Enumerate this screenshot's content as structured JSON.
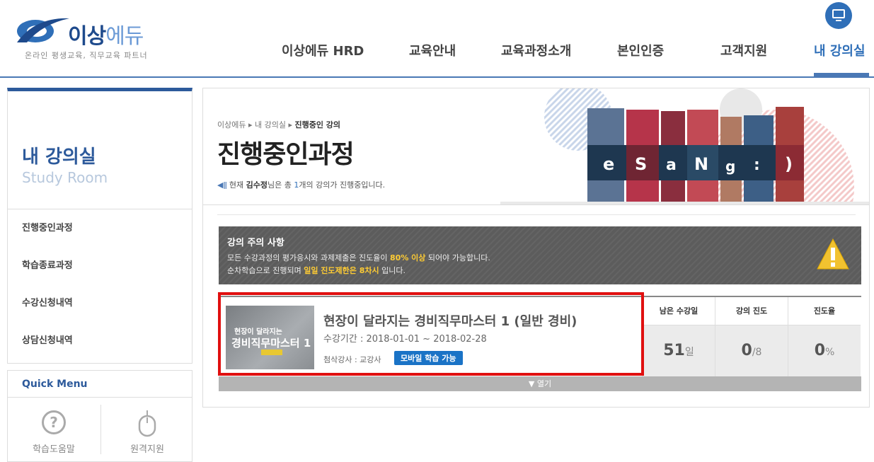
{
  "header": {
    "logo_text": "이상",
    "logo_text_light": "에듀",
    "logo_sub": "온라인 평생교육, 직무교육 파트너",
    "nav": [
      {
        "label": "이상에듀 HRD"
      },
      {
        "label": "교육안내"
      },
      {
        "label": "교육과정소개"
      },
      {
        "label": "본인인증"
      },
      {
        "label": "고객지원"
      },
      {
        "label": "내 강의실"
      }
    ]
  },
  "sidebar": {
    "title": "내 강의실",
    "subtitle": "Study Room",
    "items": [
      {
        "label": "진행중인과정"
      },
      {
        "label": "학습종료과정"
      },
      {
        "label": "수강신청내역"
      },
      {
        "label": "상담신청내역"
      }
    ],
    "quick": {
      "title": "Quick Menu",
      "help_label": "학습도움말",
      "remote_label": "원격지원"
    }
  },
  "banner": {
    "breadcrumb_1": "이상에듀",
    "breadcrumb_2": "내 강의실",
    "breadcrumb_3": "진행중인 강의",
    "title": "진행중인과정",
    "desc_pre": "현재",
    "desc_name": "김수정",
    "desc_mid": "님은 총",
    "desc_count": "1",
    "desc_post": "개의 강의가 진행중입니다.",
    "book_letters": [
      "e",
      "S",
      "a",
      "N",
      "g",
      ":",
      ")"
    ]
  },
  "notice": {
    "title": "강의 주의 사항",
    "line1_pre": "모든 수강과정의 평가응시와 과제제출은 진도율이",
    "line1_hl": "80% 이상",
    "line1_post": "되어야 가능합니다.",
    "line2_pre": "순차학습으로 진행되며",
    "line2_hl": "일일 진도제한은 8차시",
    "line2_post": "입니다."
  },
  "course": {
    "thumb_line1": "현장이 달라지는",
    "thumb_line2": "경비직무마스터 1",
    "title": "현장이 달라지는 경비직무마스터 1 (일반 경비)",
    "period": "수강기간 : 2018-01-01 ~ 2018-02-28",
    "teacher": "첨삭강사 : 교강사",
    "badge": "모바일 학습 가능",
    "stats": [
      {
        "head": "남은 수강일",
        "value": "51",
        "unit": "일"
      },
      {
        "head": "강의 진도",
        "value": "0",
        "unit": "/8"
      },
      {
        "head": "진도율",
        "value": "0",
        "unit": "%"
      }
    ],
    "expand": "▼ 열기"
  }
}
